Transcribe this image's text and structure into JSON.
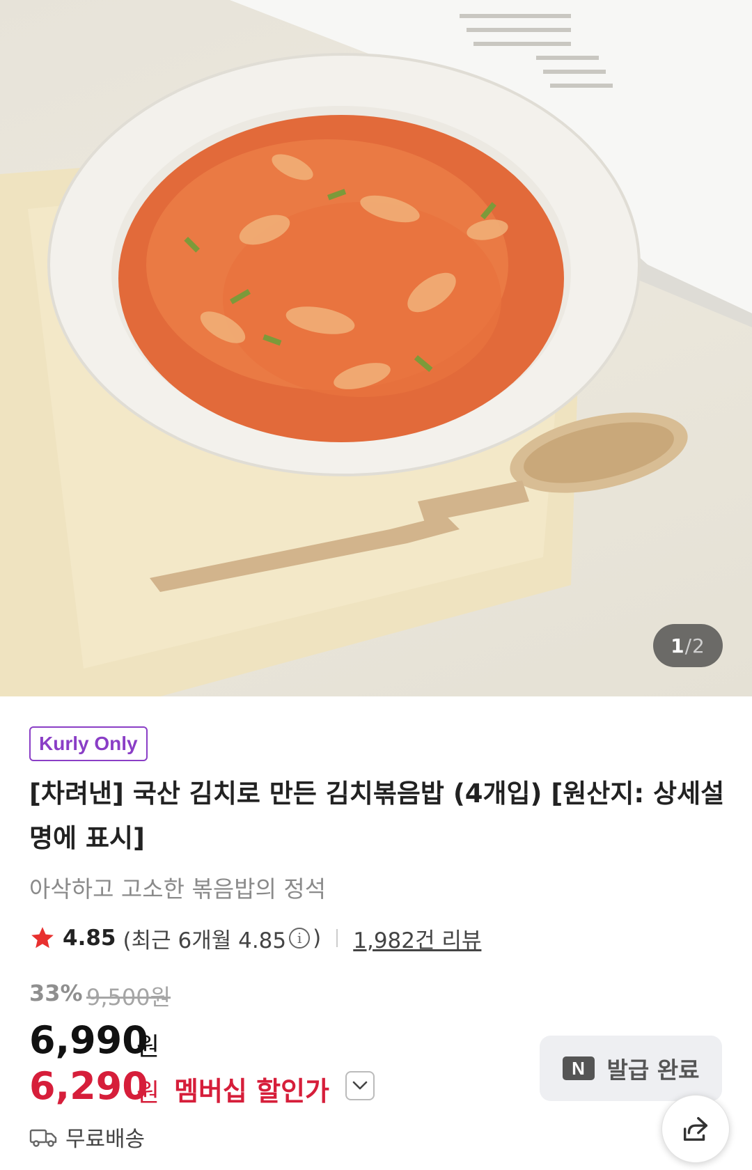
{
  "product_image": {
    "pager_current": "1",
    "pager_separator": "/",
    "pager_total": "2"
  },
  "badge": "Kurly Only",
  "title": "[차려낸] 국산 김치로 만든 김치볶음밥 (4개입) [원산지: 상세설명에 표시]",
  "subtitle": "아삭하고 고소한 볶음밥의 정석",
  "rating": {
    "score": "4.85",
    "recent_prefix": "(최근 6개월 4.85",
    "recent_suffix": ")",
    "info_icon": "i",
    "reviews": "1,982건 리뷰"
  },
  "price": {
    "discount": "33%",
    "original": "9,500원",
    "current": "6,990",
    "unit": "원",
    "member": "6,290",
    "member_unit": "원",
    "member_label": "멤버십 할인가"
  },
  "coupon": {
    "logo": "N",
    "label": "발급 완료"
  },
  "shipping": "무료배송",
  "icons": {
    "star": "star-icon",
    "info": "info-icon",
    "chevron": "chevron-down-icon",
    "truck": "truck-icon",
    "share": "share-icon"
  },
  "colors": {
    "accent_purple": "#8a3ec6",
    "member_red": "#d61e3a",
    "star_red": "#e8302f"
  }
}
